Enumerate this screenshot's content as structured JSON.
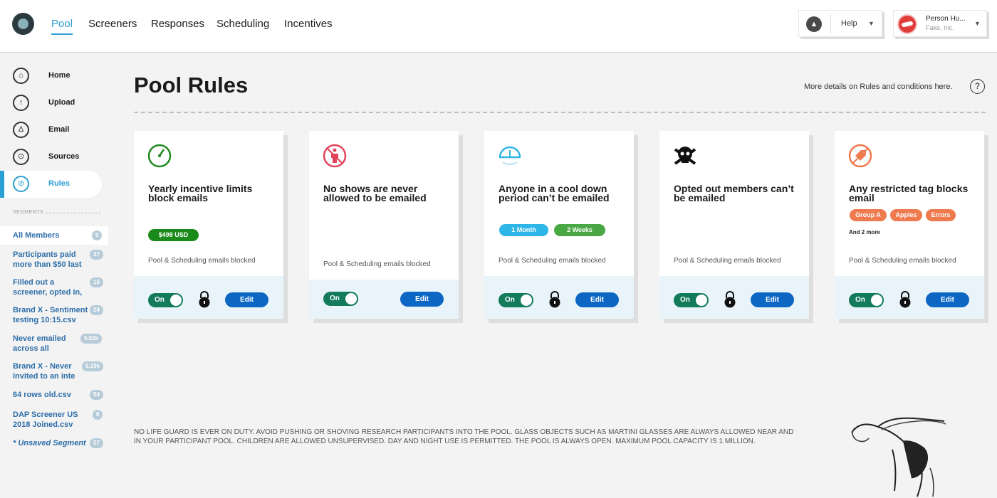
{
  "nav": {
    "items": [
      {
        "label": "Pool",
        "active": true
      },
      {
        "label": "Screeners"
      },
      {
        "label": "Responses"
      },
      {
        "label": "Scheduling"
      },
      {
        "label": "Incentives"
      }
    ],
    "help_label": "Help",
    "user": {
      "name": "Person Hu...",
      "org": "Fake, Inc."
    }
  },
  "sidebar": {
    "items": [
      {
        "label": "Home",
        "icon": "home-icon"
      },
      {
        "label": "Upload",
        "icon": "upload-icon"
      },
      {
        "label": "Email",
        "icon": "email-icon"
      },
      {
        "label": "Sources",
        "icon": "sources-icon"
      },
      {
        "label": "Rules",
        "icon": "rules-icon",
        "active": true
      }
    ],
    "segments_heading": "SEGMENTS",
    "segments": [
      {
        "name": "All Members",
        "count": "0",
        "selected": true
      },
      {
        "name": "Participants paid more than $50 last",
        "count": "37"
      },
      {
        "name": "Filled out a screener, opted in, but ne",
        "count": "15"
      },
      {
        "name": "Brand X - Sentiment testing 10:15.csv",
        "count": "24"
      },
      {
        "name": "Never emailed across all sources",
        "count": "5.02k"
      },
      {
        "name": "Brand X - Never invited to an inte",
        "count": "6.19k"
      },
      {
        "name": "64 rows old.csv",
        "count": "54"
      },
      {
        "name": "DAP Screener US 2018 Joined.csv",
        "count": "6"
      },
      {
        "name": "* Unsaved Segment",
        "count": "57",
        "italic": true
      }
    ]
  },
  "main": {
    "title": "Pool Rules",
    "details_link": "More details on Rules and conditions here.",
    "help_glyph": "?"
  },
  "cards": [
    {
      "title": "Yearly incentive limits block emails",
      "icon": "gauge-icon",
      "pills": [
        {
          "label": "$499 USD",
          "color": "#1a8a1a"
        }
      ],
      "status": "Pool & Scheduling emails blocked",
      "toggle": "On",
      "edit": "Edit"
    },
    {
      "title": "No shows are never allowed to be emailed",
      "icon": "no-person-icon",
      "pills": [],
      "status": "Pool & Scheduling emails blocked",
      "toggle": "On",
      "edit": "Edit"
    },
    {
      "title": "Anyone in a cool down period can’t be emailed",
      "icon": "sunset-icon",
      "pills": [
        {
          "label": "1 Month",
          "color": "#2fb6e8"
        },
        {
          "label": "2 Weeks",
          "color": "#4aa844"
        }
      ],
      "status": "Pool & Scheduling emails blocked",
      "toggle": "On",
      "edit": "Edit"
    },
    {
      "title": "Opted out members can’t be emailed",
      "icon": "skull-icon",
      "pills": [],
      "status": "Pool & Scheduling emails blocked",
      "toggle": "On",
      "edit": "Edit"
    },
    {
      "title": "Any restricted tag blocks email",
      "icon": "no-tag-icon",
      "pills": [
        {
          "label": "Group A",
          "color": "#ee7a4e"
        },
        {
          "label": "Apples",
          "color": "#ee7a4e"
        },
        {
          "label": "Errors",
          "color": "#ee7a4e"
        }
      ],
      "more": "And 2 more",
      "status": "Pool & Scheduling emails blocked",
      "toggle": "On",
      "edit": "Edit"
    }
  ],
  "disclaimer": "NO LIFE GUARD IS EVER ON DUTY. AVOID PUSHING OR SHOVING RESEARCH PARTICIPANTS INTO THE POOL. GLASS OBJECTS SUCH AS MARTINI GLASSES ARE ALWAYS ALLOWED NEAR AND IN YOUR PARTICIPANT POOL. CHILDREN ARE ALLOWED UNSUPERVISED. DAY AND NIGHT USE IS PERMITTED. THE POOL IS ALWAYS OPEN. MAXIMUM POOL CAPACITY IS 1 MILLION."
}
